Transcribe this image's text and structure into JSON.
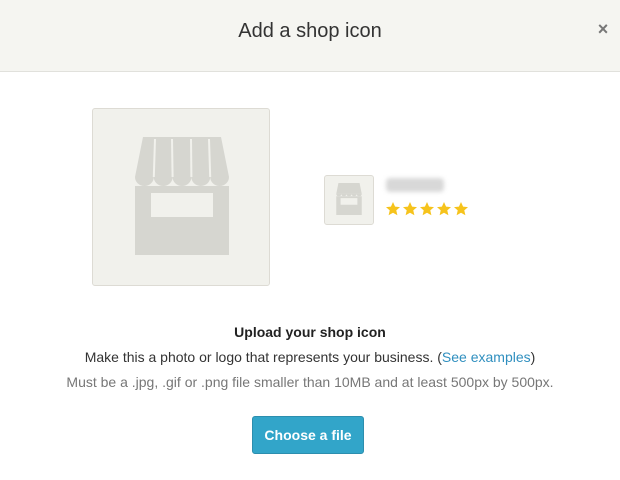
{
  "modal": {
    "title": "Add a shop icon",
    "close_glyph": "×"
  },
  "preview": {
    "large_icon": "storefront-placeholder-icon",
    "small_icon": "storefront-placeholder-icon",
    "shop_name": "shopname",
    "rating": 5,
    "rating_max": 5,
    "star_color": "#f6c31c",
    "placeholder_color": "#d6d6d0"
  },
  "upload": {
    "title": "Upload your shop icon",
    "description_prefix": "Make this a photo or logo that represents your business. (",
    "examples_link": "See examples",
    "description_suffix": ")",
    "requirements": "Must be a .jpg, .gif or .png file smaller than 10MB and at least 500px by 500px.",
    "button_label": "Choose a file",
    "button_color": "#32a5c9",
    "link_color": "#2f8fbf"
  }
}
